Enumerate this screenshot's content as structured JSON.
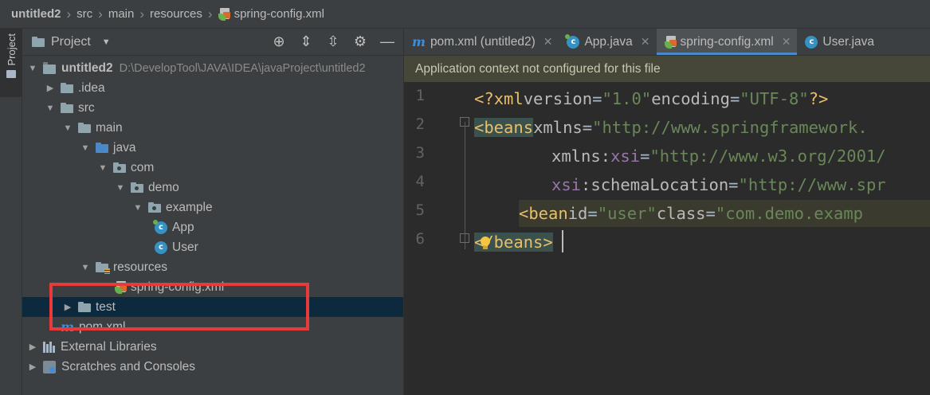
{
  "breadcrumb": {
    "items": [
      "untitled2",
      "src",
      "main",
      "resources",
      "spring-config.xml"
    ]
  },
  "left_strip": {
    "project_label": "Project"
  },
  "project_panel": {
    "title": "Project",
    "tree": {
      "root_name": "untitled2",
      "root_path": "D:\\DevelopTool\\JAVA\\IDEA\\javaProject\\untitled2",
      "idea": ".idea",
      "src": "src",
      "main": "main",
      "java": "java",
      "com": "com",
      "demo": "demo",
      "example": "example",
      "app": "App",
      "user": "User",
      "resources": "resources",
      "spring_config": "spring-config.xml",
      "test": "test",
      "pom": "pom.xml",
      "external_libraries": "External Libraries",
      "scratches": "Scratches and Consoles"
    }
  },
  "editor": {
    "tabs": [
      {
        "label": "pom.xml (untitled2)",
        "icon": "maven-icon"
      },
      {
        "label": "App.java",
        "icon": "class-icon"
      },
      {
        "label": "spring-config.xml",
        "icon": "xml-file-icon",
        "active": true
      },
      {
        "label": "User.java",
        "icon": "class-icon"
      }
    ],
    "banner": "Application context not configured for this file",
    "line_numbers": [
      "1",
      "2",
      "3",
      "4",
      "5",
      "6"
    ],
    "code": {
      "l1": {
        "open": "<?",
        "tag": "xml",
        "a1": "version",
        "v1": "\"1.0\"",
        "a2": "encoding",
        "v2": "\"UTF-8\"",
        "close": "?>"
      },
      "l2": {
        "tag": "<beans",
        "attr": "xmlns",
        "val": "\"http://www.springframework."
      },
      "l3": {
        "ns": "xmlns",
        "colon": ":",
        "ns2": "xsi",
        "val": "\"http://www.w3.org/2001/"
      },
      "l4": {
        "ns": "xsi",
        "attr": ":schemaLocation",
        "val": "\"http://www.spr"
      },
      "l5": {
        "tag": "<bean",
        "a1": "id",
        "v1": "\"user\"",
        "a2": "class",
        "v2": "\"com.demo.examp"
      },
      "l6": {
        "tag": "</beans>"
      }
    }
  },
  "colors": {
    "highlight_box": "#e83a3a",
    "active_tab_underline": "#4a88c7",
    "banner_bg": "#464639"
  }
}
